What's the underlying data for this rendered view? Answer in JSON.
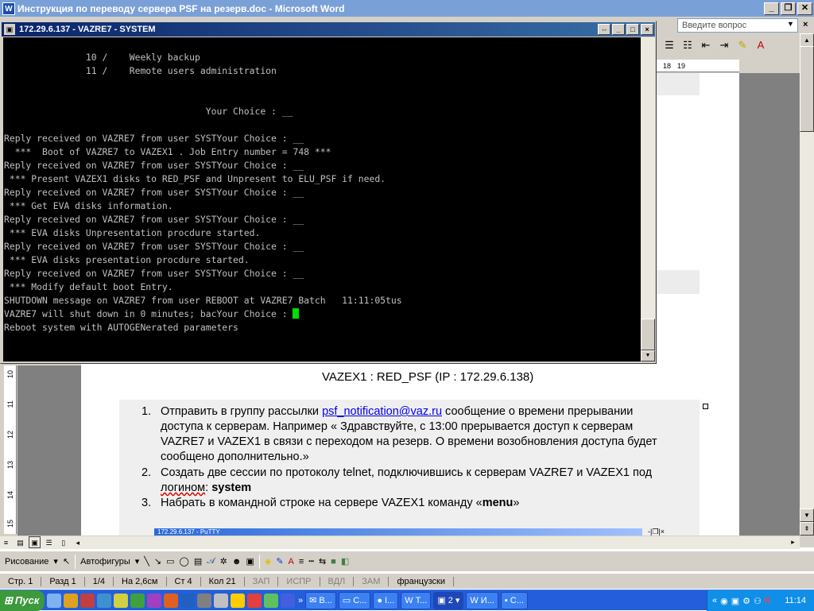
{
  "word": {
    "title": "Инструкция по переводу сервера PSF на резерв.doc - Microsoft Word",
    "ask_placeholder": "Введите вопрос",
    "ruler_marks": [
      "18",
      "19"
    ],
    "vruler_marks": [
      "10",
      "11",
      "12",
      "13",
      "14",
      "15"
    ],
    "heading_line": "VAZEX1 : RED_PSF (IP : 172.29.6.138)",
    "list": [
      {
        "num": "1.",
        "pre": "Отправить в группу рассылки ",
        "link": "psf_notification@vaz.ru",
        "post": " сообщение о времени прерывании доступа к серверам. Например « Здравствуйте, с 13:00 прерывается доступ к серверам VAZRE7 и VAZEX1 в связи с переходом на резерв. О времени возобновления доступа будет сообщено дополнительно.»"
      },
      {
        "num": "2.",
        "pre": "Создать две сессии по протоколу telnet, подключившись к серверам VAZRE7 и VAZEX1 под ",
        "squig": "логином",
        "colon": ": ",
        "bold": "system"
      },
      {
        "num": "3.",
        "pre": "Набрать в командной строке на сервере VAZEX1 команду «",
        "bold": "menu",
        "post": "»"
      }
    ],
    "embedded_title": "172.29.6.137 - PuTTY",
    "drawing_label": "Рисование",
    "autoshapes_label": "Автофигуры",
    "status": {
      "page": "Стр. 1",
      "section": "Разд 1",
      "pages": "1/4",
      "at": "На 2,6см",
      "line": "Ст 4",
      "col": "Кол 21",
      "rec": "ЗАП",
      "trk": "ИСПР",
      "ext": "ВДЛ",
      "ovr": "ЗАМ",
      "lang": "французски"
    }
  },
  "putty": {
    "title": "172.29.6.137 - VAZRE7 - SYSTEM",
    "lines": [
      "               10 /    Weekly backup",
      "               11 /    Remote users administration",
      "",
      "",
      "                                     Your Choice : __",
      "",
      "Reply received on VAZRE7 from user SYSTYour Choice : __",
      "  ***  Boot of VAZRE7 to VAZEX1 . Job Entry number = 748 ***",
      "Reply received on VAZRE7 from user SYSTYour Choice : __",
      " *** Present VAZEX1 disks to RED_PSF and Unpresent to ELU_PSF if need.",
      "Reply received on VAZRE7 from user SYSTYour Choice : __",
      " *** Get EVA disks information.",
      "Reply received on VAZRE7 from user SYSTYour Choice : __",
      " *** EVA disks Unpresentation procdure started.",
      "Reply received on VAZRE7 from user SYSTYour Choice : __",
      " *** EVA disks presentation procdure started.",
      "Reply received on VAZRE7 from user SYSTYour Choice : __",
      " *** Modify default boot Entry.",
      "SHUTDOWN message on VAZRE7 from user REBOOT at VAZRE7 Batch   11:11:05tus",
      "VAZRE7 will shut down in 0 minutes; bacYour Choice : ",
      "Reboot system with AUTOGENerated parameters"
    ]
  },
  "taskbar": {
    "start": "Пуск",
    "tasks": [
      {
        "label": "В..."
      },
      {
        "label": "С..."
      },
      {
        "label": "I..."
      },
      {
        "label": "Т..."
      },
      {
        "label": "2"
      },
      {
        "label": "И..."
      },
      {
        "label": "С..."
      }
    ],
    "clock": "11:14"
  }
}
